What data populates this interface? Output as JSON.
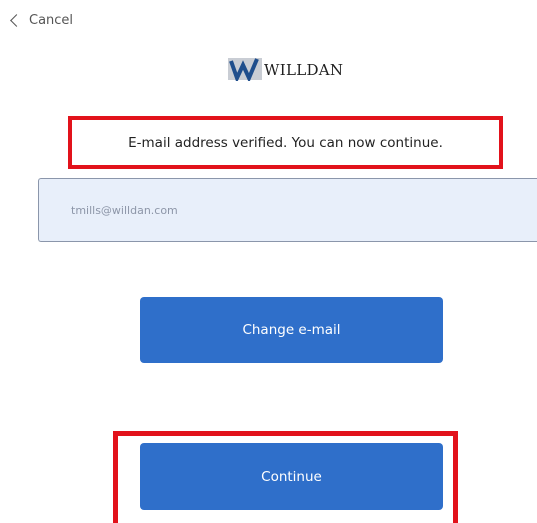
{
  "nav": {
    "cancel_label": "Cancel"
  },
  "brand": {
    "logo_text": "WILLDAN",
    "logo_color": "#1f4e8c"
  },
  "status": {
    "message": "E-mail address verified. You can now continue."
  },
  "email": {
    "value": "tmills@willdan.com"
  },
  "buttons": {
    "change_email": "Change e-mail",
    "continue": "Continue"
  },
  "colors": {
    "primary_button": "#2f6fca",
    "highlight_outline": "#e2121b",
    "input_background": "#e8effa"
  }
}
